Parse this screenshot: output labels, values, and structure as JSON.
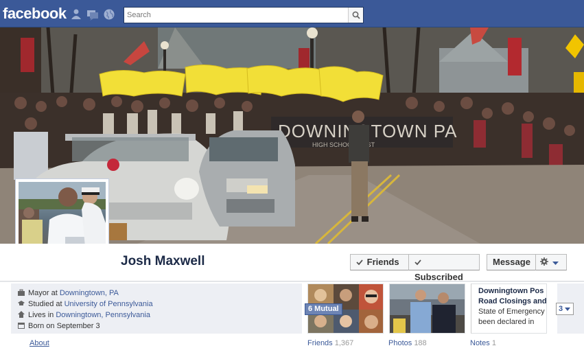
{
  "topbar": {
    "logo": "facebook",
    "search_placeholder": "Search",
    "icons": [
      "friend-requests-icon",
      "messages-icon",
      "notifications-globe-icon",
      "search-icon"
    ]
  },
  "cover": {
    "banner_text": "DOWNINGTOWN PA",
    "banner_subtext": "HIGH SCHOOL WEST"
  },
  "profile": {
    "name": "Josh Maxwell",
    "buttons": {
      "friends": "Friends",
      "subscribed": "Subscribed",
      "message": "Message"
    }
  },
  "facts": [
    {
      "prefix": "Mayor at ",
      "link": "Downingtown, PA",
      "icon": "briefcase-icon"
    },
    {
      "prefix": "Studied at ",
      "link": "University of Pennsylvania",
      "icon": "graduation-cap-icon"
    },
    {
      "prefix": "Lives in ",
      "link": "Downingtown, Pennsylvania",
      "icon": "house-icon"
    },
    {
      "prefix": "Born on September 3",
      "link": "",
      "icon": "calendar-icon"
    }
  ],
  "about_label": "About",
  "tiles": {
    "friends": {
      "label": "Friends",
      "count": "1,367",
      "mutual": "6 Mutual"
    },
    "photos": {
      "label": "Photos",
      "count": "188"
    },
    "notes": {
      "label": "Notes",
      "count": "1",
      "title_lines": [
        "Downingtown Pos",
        "Road Closings and"
      ],
      "body_lines": [
        "State of Emergency h",
        "been declared in"
      ]
    },
    "more_count": "3"
  },
  "colors": {
    "brand": "#3b5998",
    "link": "#3b5998",
    "topbar": "#3b5998",
    "facts_bg": "#edeff4"
  }
}
